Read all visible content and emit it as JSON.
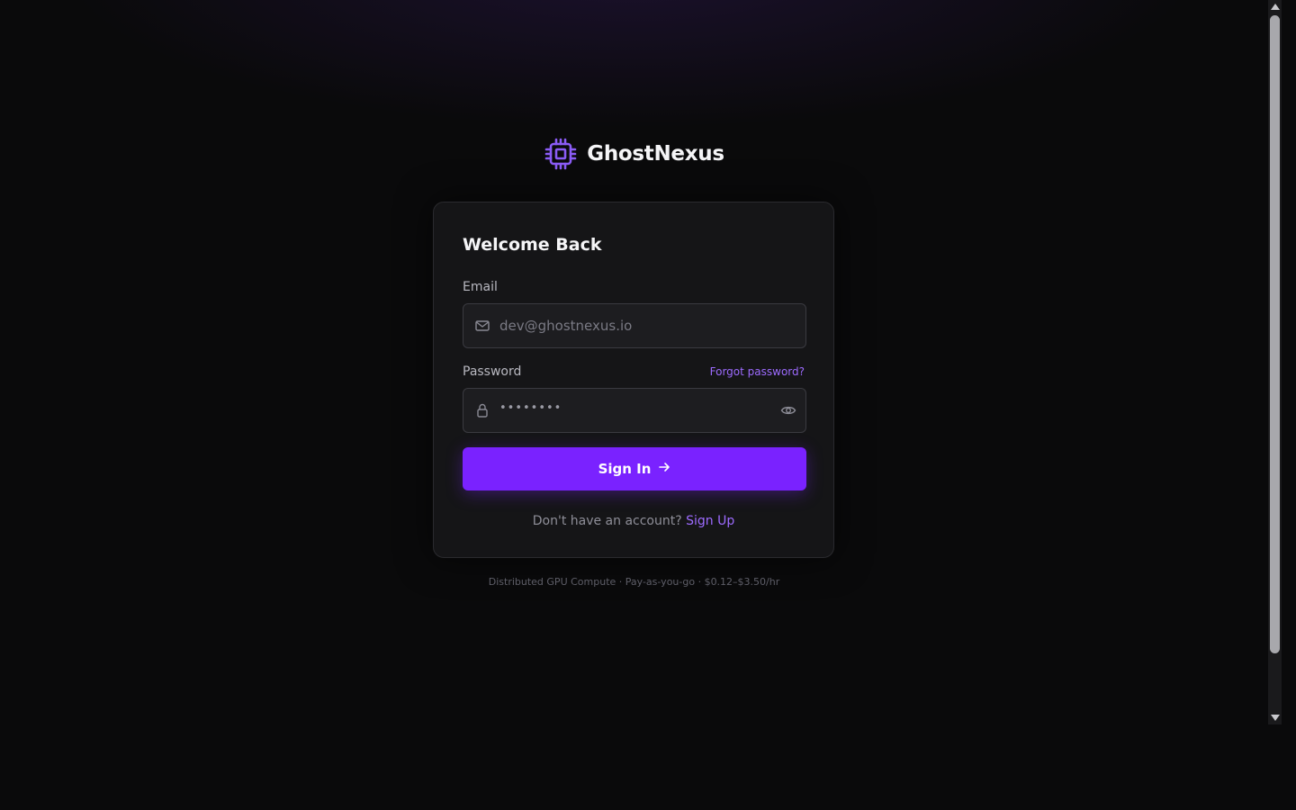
{
  "brand": {
    "name": "GhostNexus",
    "icon": "cpu-chip-icon",
    "accent_color": "#8b5cf6"
  },
  "card": {
    "title": "Welcome Back",
    "email": {
      "label": "Email",
      "placeholder": "dev@ghostnexus.io",
      "value": "",
      "icon": "mail-icon"
    },
    "password": {
      "label": "Password",
      "masked_value": "••••••••",
      "icon": "lock-icon",
      "toggle_icon": "eye-icon",
      "forgot_label": "Forgot password?"
    },
    "sign_in_label": "Sign In",
    "sign_in_icon": "arrow-right-icon",
    "sign_in_color": "#7a22ff",
    "signup_prompt": "Don't have an account?",
    "signup_link": "Sign Up"
  },
  "footer": {
    "text": "Distributed GPU Compute · Pay-as-you-go · $0.12–$3.50/hr"
  }
}
